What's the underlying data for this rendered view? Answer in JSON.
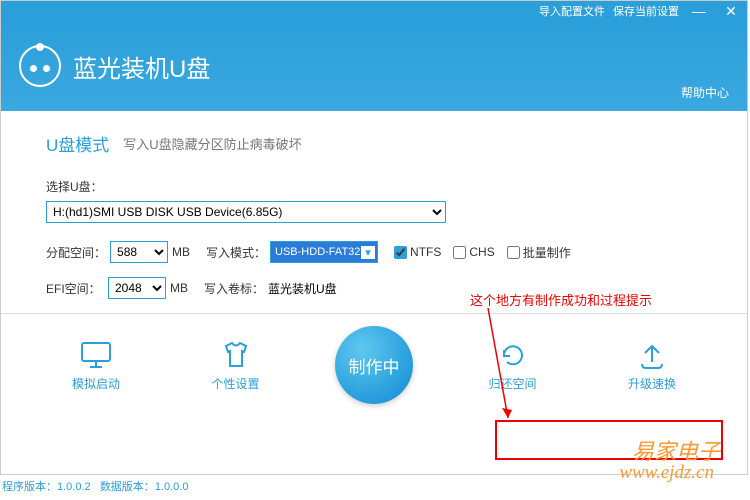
{
  "titlebar": {
    "import_config": "导入配置文件",
    "save_settings": "保存当前设置"
  },
  "header": {
    "app_title": "蓝光装机U盘",
    "help": "帮助中心"
  },
  "mode": {
    "title": "U盘模式",
    "desc": "写入U盘隐藏分区防止病毒破坏"
  },
  "form": {
    "select_usb_label": "选择U盘：",
    "select_usb_value": "H:(hd1)SMI USB DISK USB Device(6.85G)",
    "alloc_label": "分配空间：",
    "alloc_value": "588",
    "alloc_unit": "MB",
    "write_mode_label": "写入模式：",
    "write_mode_value": "USB-HDD-FAT32",
    "ntfs_label": "NTFS",
    "ntfs_checked": true,
    "chs_label": "CHS",
    "chs_checked": false,
    "batch_label": "批量制作",
    "batch_checked": false,
    "efi_label": "EFI空间：",
    "efi_value": "2048",
    "efi_unit": "MB",
    "volname_label": "写入卷标：",
    "volname_value": "蓝光装机U盘"
  },
  "actions": {
    "sim_boot": "模拟启动",
    "personal": "个性设置",
    "make": "制作中",
    "restore": "归还空间",
    "upgrade": "升级速换"
  },
  "footer": {
    "prog_ver_label": "程序版本：",
    "prog_ver": "1.0.0.2",
    "data_ver_label": "数据版本：",
    "data_ver": "1.0.0.0"
  },
  "annotation": {
    "text": "这个地方有制作成功和过程提示"
  },
  "watermark": {
    "name": "易家电子",
    "url": "www.ejdz.cn"
  }
}
